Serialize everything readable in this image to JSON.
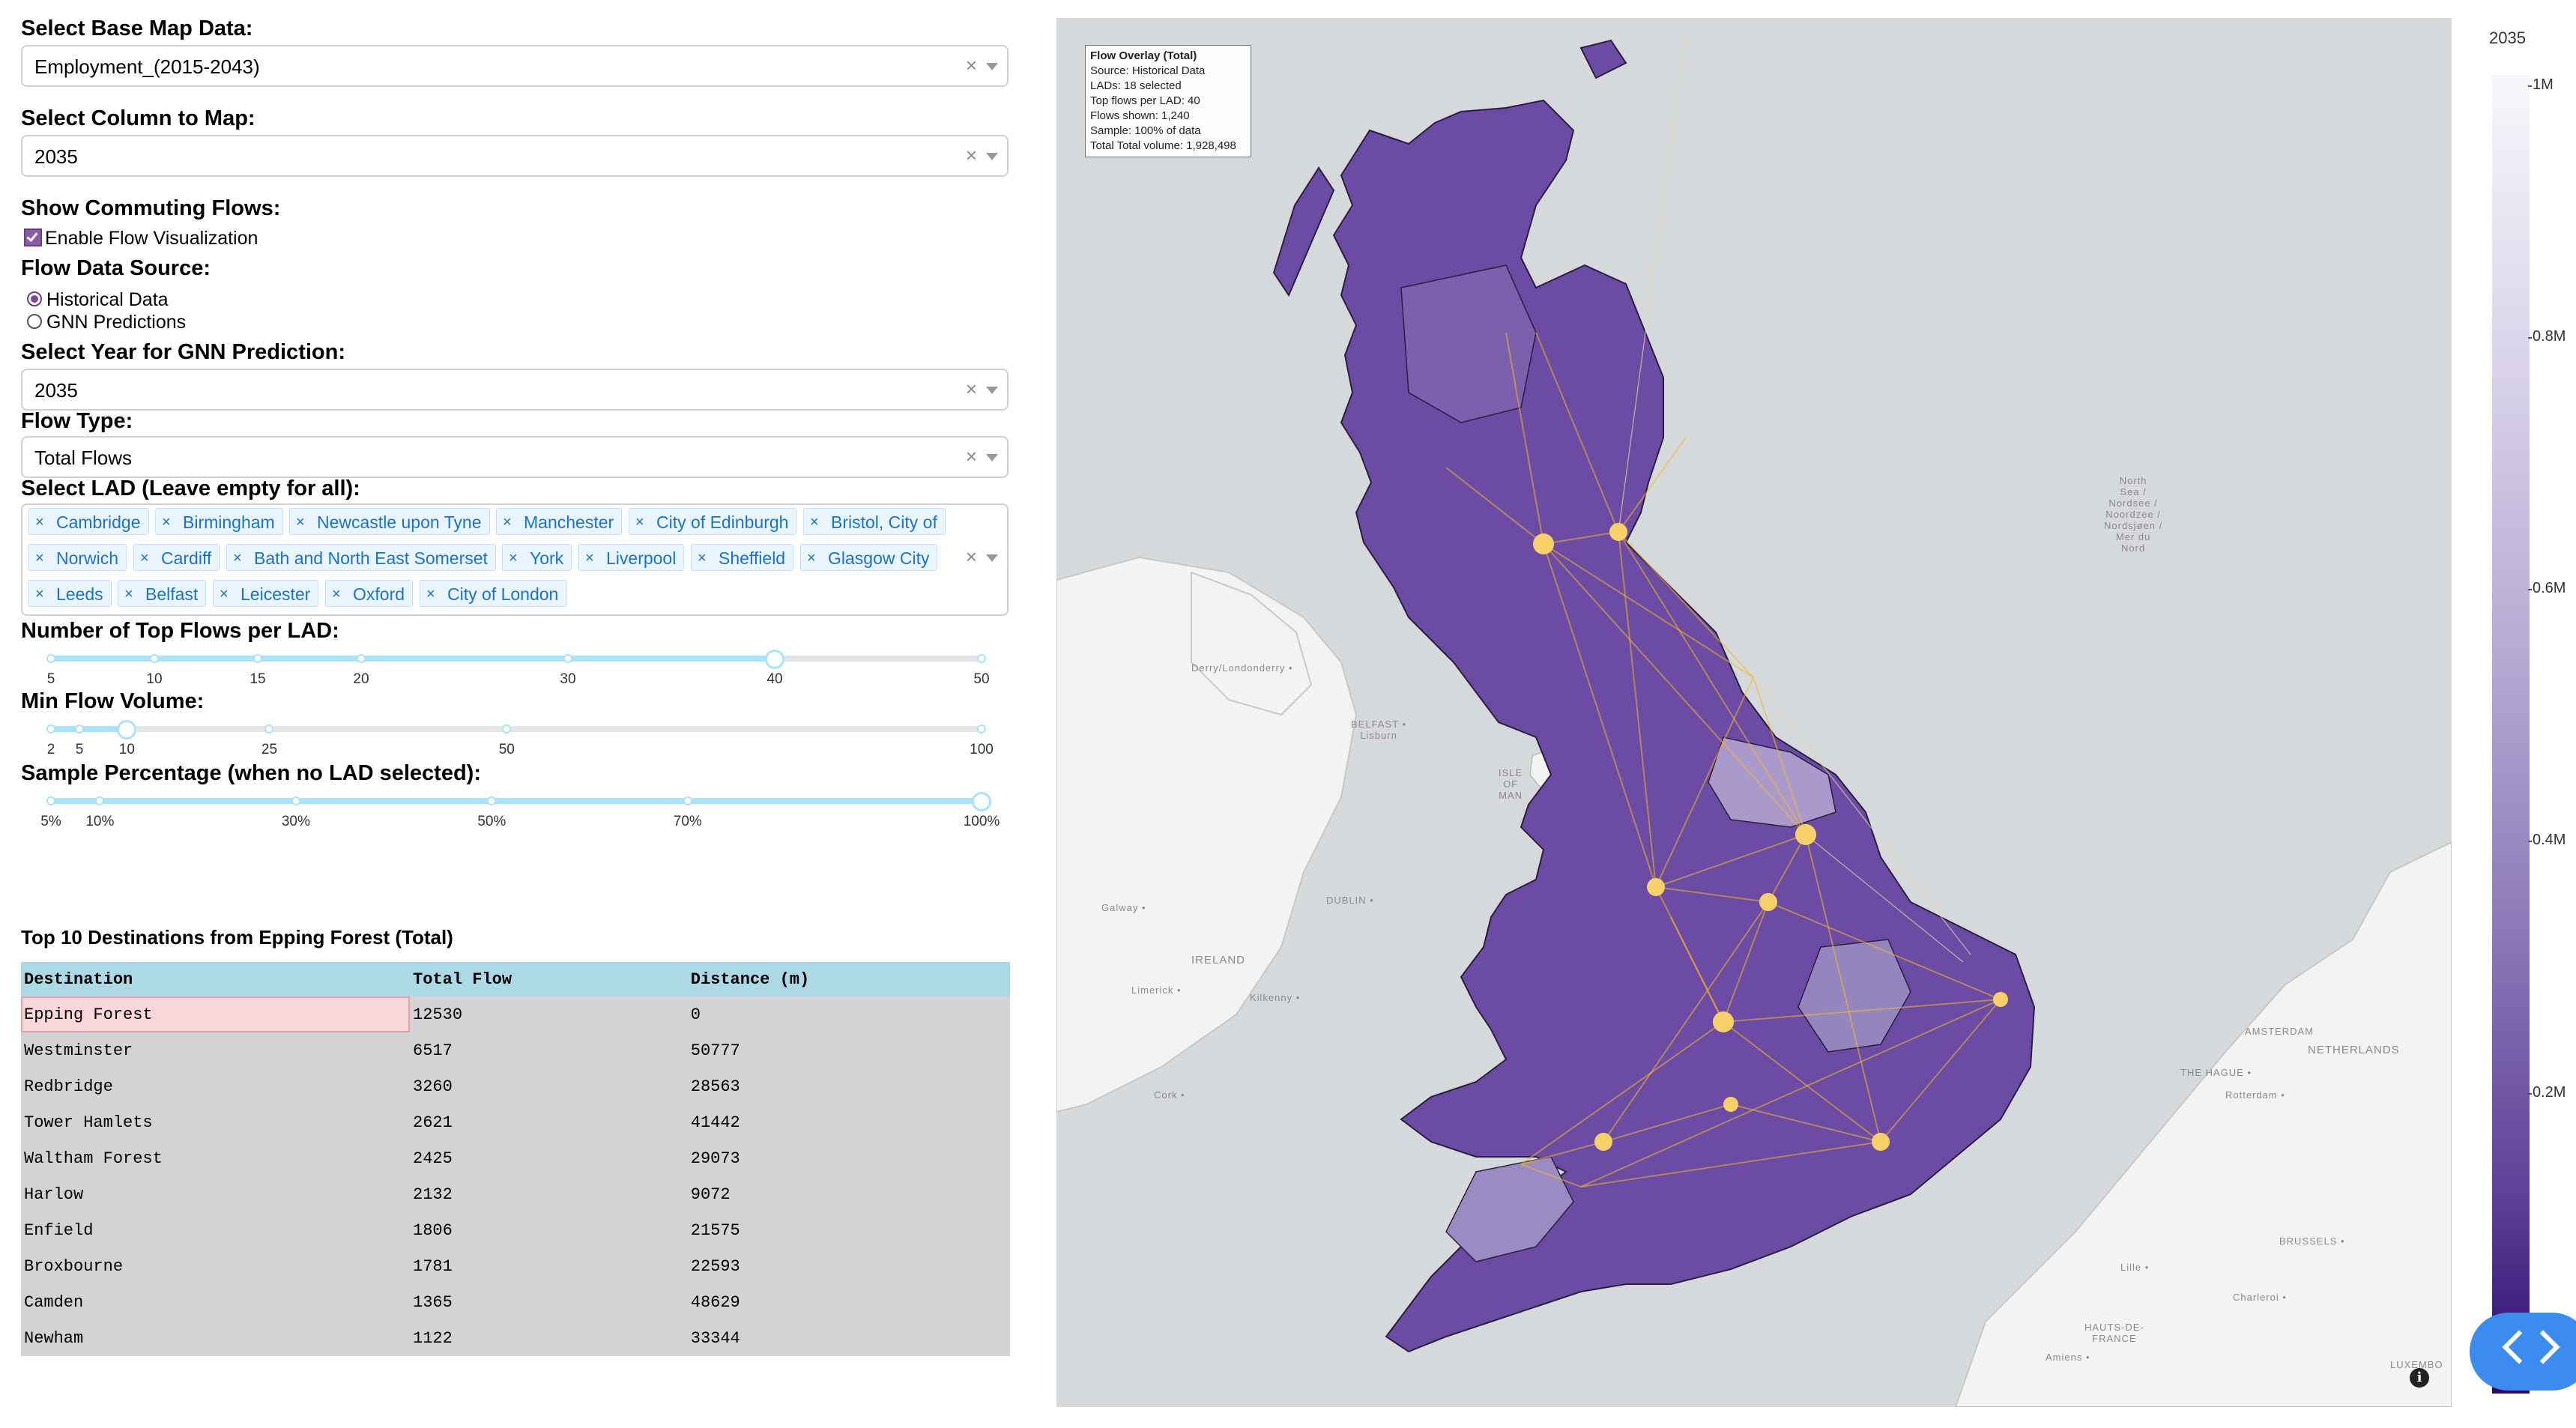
{
  "controls": {
    "base_map": {
      "label": "Select Base Map Data:",
      "value": "Employment_(2015-2043)"
    },
    "column": {
      "label": "Select Column to Map:",
      "value": "2035"
    },
    "flows": {
      "label": "Show Commuting Flows:",
      "checkbox_label": "Enable Flow Visualization",
      "checked": true
    },
    "flow_source": {
      "label": "Flow Data Source:",
      "options": [
        "Historical Data",
        "GNN Predictions"
      ],
      "selected": "Historical Data"
    },
    "gnn_year": {
      "label": "Select Year for GNN Prediction:",
      "value": "2035"
    },
    "flow_type": {
      "label": "Flow Type:",
      "value": "Total Flows"
    },
    "lad": {
      "label": "Select LAD (Leave empty for all):",
      "selected": [
        "Cambridge",
        "Birmingham",
        "Newcastle upon Tyne",
        "Manchester",
        "City of Edinburgh",
        "Bristol, City of",
        "Norwich",
        "Cardiff",
        "Bath and North East Somerset",
        "York",
        "Liverpool",
        "Sheffield",
        "Glasgow City",
        "Leeds",
        "Belfast",
        "Leicester",
        "Oxford",
        "City of London"
      ]
    },
    "top_flows": {
      "label": "Number of Top Flows per LAD:",
      "value": 40,
      "marks": [
        "5",
        "10",
        "15",
        "20",
        "30",
        "40",
        "50"
      ]
    },
    "min_volume": {
      "label": "Min Flow Volume:",
      "value": 10,
      "marks": [
        "2",
        "5",
        "10",
        "25",
        "50",
        "100"
      ]
    },
    "sample_pct": {
      "label": "Sample Percentage (when no LAD selected):",
      "value": 100,
      "marks": [
        "5%",
        "10%",
        "30%",
        "50%",
        "70%",
        "100%"
      ]
    }
  },
  "table": {
    "title": "Top 10 Destinations from Epping Forest (Total)",
    "columns": [
      "Destination",
      "Total Flow",
      "Distance (m)"
    ],
    "rows": [
      [
        "Epping Forest",
        "12530",
        "0"
      ],
      [
        "Westminster",
        "6517",
        "50777"
      ],
      [
        "Redbridge",
        "3260",
        "28563"
      ],
      [
        "Tower Hamlets",
        "2621",
        "41442"
      ],
      [
        "Waltham Forest",
        "2425",
        "29073"
      ],
      [
        "Harlow",
        "2132",
        "9072"
      ],
      [
        "Enfield",
        "1806",
        "21575"
      ],
      [
        "Broxbourne",
        "1781",
        "22593"
      ],
      [
        "Camden",
        "1365",
        "48629"
      ],
      [
        "Newham",
        "1122",
        "33344"
      ]
    ]
  },
  "map": {
    "overlay_title": "Flow Overlay (Total)",
    "overlay_lines": [
      "Source: Historical Data",
      "LADs: 18 selected",
      "Top flows per LAD: 40",
      "Flows shown: 1,240",
      "Sample: 100% of data",
      "Total Total volume: 1,928,498"
    ],
    "basemap_labels": {
      "north_sea": "North\nSea /\nNordsee /\nNoordzee /\nNordsjøen /\nMer du\nNord",
      "ireland": "IRELAND",
      "netherlands": "NETHERLANDS",
      "belfast": "BELFAST •\nLisburn",
      "dublin": "DUBLIN •",
      "isle_of_man": "ISLE\nOF\nMAN",
      "amsterdam": "AMSTERDAM",
      "brussels": "BRUSSELS •",
      "hauts_de_france": "HAUTS-DE-\nFRANCE",
      "derry": "Derry/Londonderry •",
      "galway": "Galway •",
      "cork": "Cork •",
      "limerick": "Limerick •",
      "kilkenny": "Kilkenny •",
      "the_hague": "THE HAGUE •",
      "rotterdam": "Rotterdam •",
      "luxembourg": "LUXEMBO",
      "lille": "Lille •",
      "amiens": "Amiens •",
      "charleroi": "Charleroi •"
    },
    "region_color": "#6b4ba3",
    "flow_color": "#f5b52e",
    "info_icon": "info-icon"
  },
  "colorbar": {
    "title": "2035",
    "ticks": [
      "1M",
      "0.8M",
      "0.6M",
      "0.4M",
      "0.2M"
    ],
    "tick_values": [
      1000000,
      800000,
      600000,
      400000,
      200000
    ],
    "range": [
      0,
      1000000
    ]
  },
  "fab": {
    "icon": "code-brackets-icon",
    "color": "#3c8cf0"
  }
}
